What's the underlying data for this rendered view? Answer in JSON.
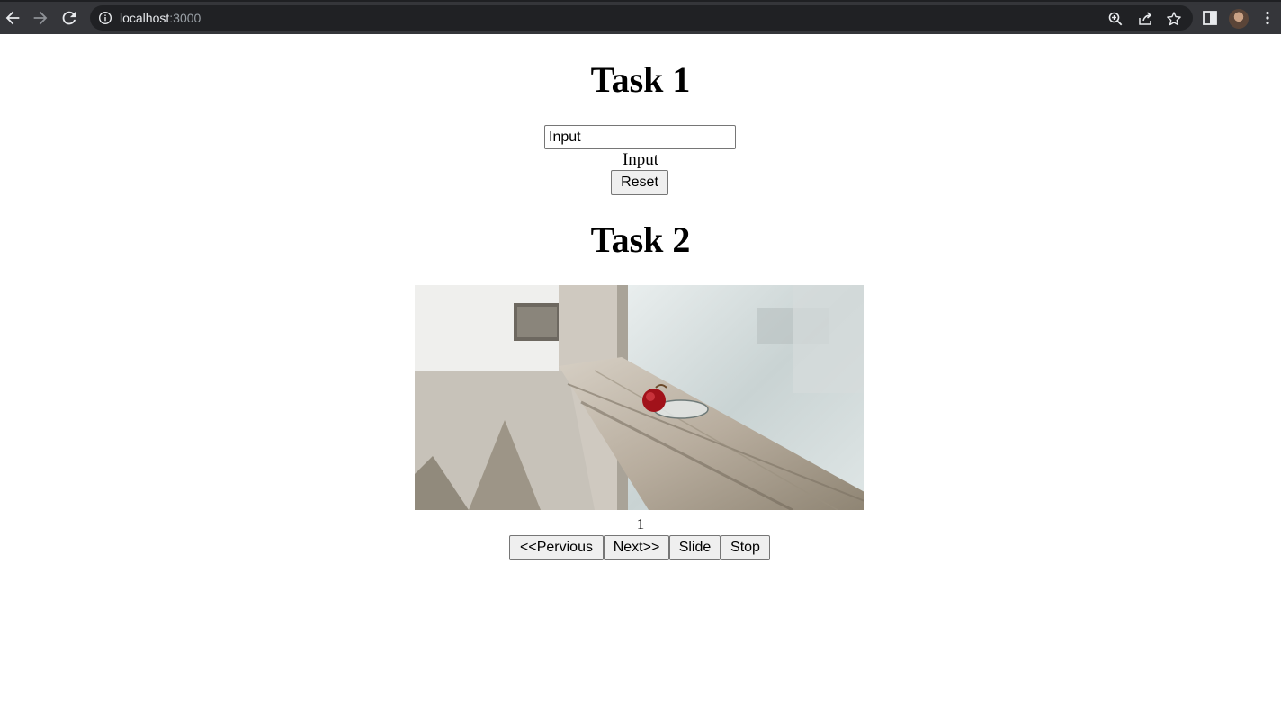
{
  "browser": {
    "url_host": "localhost",
    "url_port": ":3000",
    "icons": [
      "back-arrow-icon",
      "forward-arrow-icon",
      "reload-icon",
      "info-icon",
      "zoom-icon",
      "share-icon",
      "star-icon",
      "side-panel-icon",
      "profile-avatar",
      "more-vert-icon"
    ]
  },
  "task1": {
    "title": "Task 1",
    "input_value": "Input",
    "echo_text": "Input",
    "reset_label": "Reset"
  },
  "task2": {
    "title": "Task 2",
    "slide_number": "1",
    "buttons": {
      "previous": "<<Pervious",
      "next": "Next>>",
      "slide": "Slide",
      "stop": "Stop"
    }
  }
}
